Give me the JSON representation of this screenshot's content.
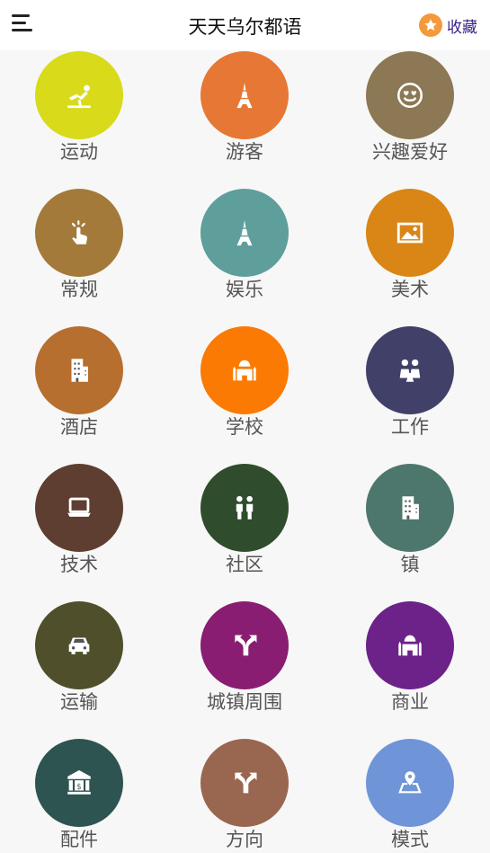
{
  "header": {
    "title": "天天乌尔都语",
    "favorites_label": "收藏"
  },
  "categories": [
    {
      "label": "运动",
      "color": "#d8da1a",
      "icon": "sport-icon"
    },
    {
      "label": "游客",
      "color": "#e67734",
      "icon": "eiffel-tower-icon"
    },
    {
      "label": "兴趣爱好",
      "color": "#8c7855",
      "icon": "heart-eyes-emoji-icon"
    },
    {
      "label": "常规",
      "color": "#a37a3a",
      "icon": "tap-hand-icon"
    },
    {
      "label": "娱乐",
      "color": "#5e9e9b",
      "icon": "eiffel-tower-icon"
    },
    {
      "label": "美术",
      "color": "#d98617",
      "icon": "picture-icon"
    },
    {
      "label": "酒店",
      "color": "#b66f2e",
      "icon": "building-icon"
    },
    {
      "label": "学校",
      "color": "#fb7a03",
      "icon": "palace-icon"
    },
    {
      "label": "工作",
      "color": "#414069",
      "icon": "people-meeting-icon"
    },
    {
      "label": "技术",
      "color": "#5e3e31",
      "icon": "laptop-icon"
    },
    {
      "label": "社区",
      "color": "#2f4d2c",
      "icon": "people-icon"
    },
    {
      "label": "镇",
      "color": "#4d776c",
      "icon": "building-icon"
    },
    {
      "label": "运输",
      "color": "#4f4f2c",
      "icon": "car-icon"
    },
    {
      "label": "城镇周围",
      "color": "#891d71",
      "icon": "split-arrows-icon"
    },
    {
      "label": "商业",
      "color": "#6c2289",
      "icon": "palace-icon"
    },
    {
      "label": "配件",
      "color": "#2e5451",
      "icon": "bank-icon"
    },
    {
      "label": "方向",
      "color": "#996650",
      "icon": "split-arrows-icon"
    },
    {
      "label": "模式",
      "color": "#6f95d8",
      "icon": "map-pin-icon"
    }
  ]
}
